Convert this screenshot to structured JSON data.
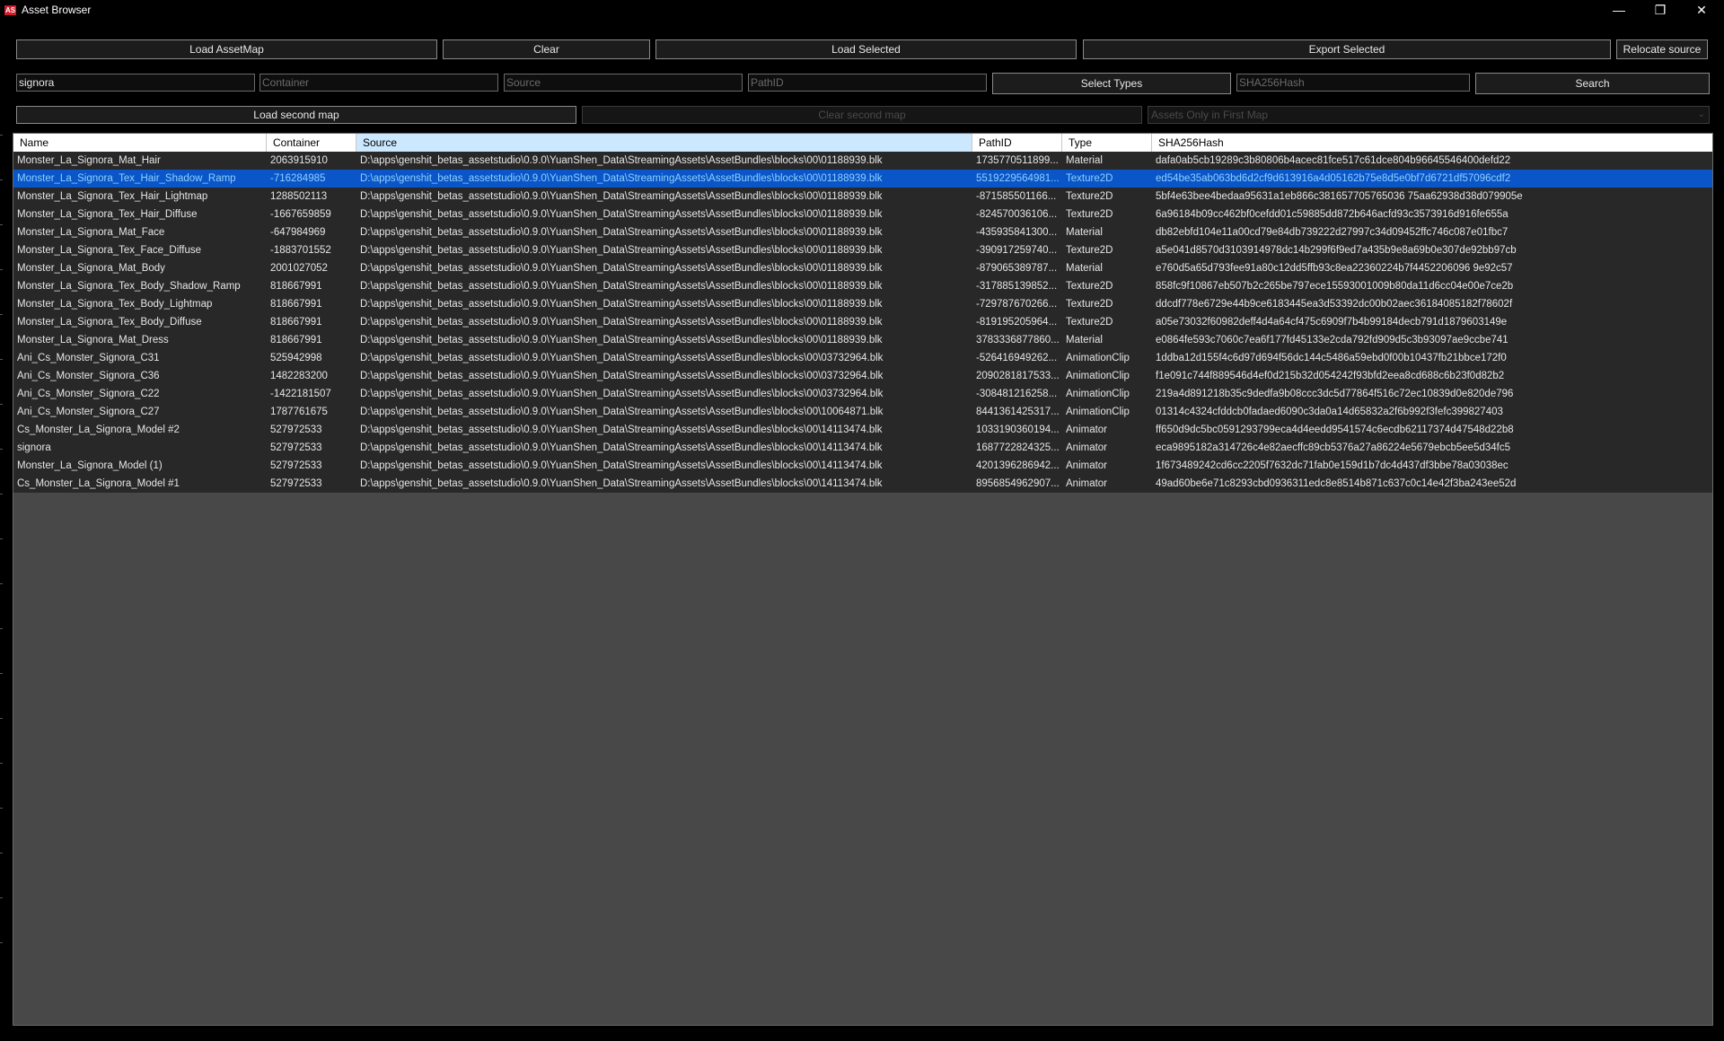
{
  "window": {
    "title": "Asset Browser",
    "icon_text": "AS",
    "minimize_glyph": "—",
    "maximize_glyph": "❐",
    "close_glyph": "✕"
  },
  "toolbar": {
    "load_assetmap": "Load AssetMap",
    "clear": "Clear",
    "load_selected": "Load Selected",
    "export_selected": "Export Selected",
    "relocate_source": "Relocate source"
  },
  "filters": {
    "name_value": "signora",
    "container_placeholder": "Container",
    "source_placeholder": "Source",
    "pathid_placeholder": "PathID",
    "select_types": "Select Types",
    "sha_placeholder": "SHA256Hash",
    "search": "Search"
  },
  "second_map": {
    "load_second_map": "Load second map",
    "clear_second_map": "Clear second map",
    "assets_only_first": "Assets Only in First Map"
  },
  "columns": [
    "Name",
    "Container",
    "Source",
    "PathID",
    "Type",
    "SHA256Hash"
  ],
  "rows": [
    {
      "name": "Monster_La_Signora_Mat_Hair",
      "container": "2063915910",
      "source": "D:\\apps\\genshit_betas_assetstudio\\0.9.0\\YuanShen_Data\\StreamingAssets\\AssetBundles\\blocks\\00\\01188939.blk",
      "pathid": "1735770511899...",
      "type": "Material",
      "hash": "dafa0ab5cb19289c3b80806b4acec81fce517c61dce804b96645546400defd22"
    },
    {
      "name": "Monster_La_Signora_Tex_Hair_Shadow_Ramp",
      "container": "-716284985",
      "source": "D:\\apps\\genshit_betas_assetstudio\\0.9.0\\YuanShen_Data\\StreamingAssets\\AssetBundles\\blocks\\00\\01188939.blk",
      "pathid": "5519229564981...",
      "type": "Texture2D",
      "hash": "ed54be35ab063bd6d2cf9d613916a4d05162b75e8d5e0bf7d6721df57096cdf2",
      "selected": true
    },
    {
      "name": "Monster_La_Signora_Tex_Hair_Lightmap",
      "container": "1288502113",
      "source": "D:\\apps\\genshit_betas_assetstudio\\0.9.0\\YuanShen_Data\\StreamingAssets\\AssetBundles\\blocks\\00\\01188939.blk",
      "pathid": "-871585501166...",
      "type": "Texture2D",
      "hash": "5bf4e63bee4bedaa95631a1eb866c381657705765036 75aa62938d38d079905e"
    },
    {
      "name": "Monster_La_Signora_Tex_Hair_Diffuse",
      "container": "-1667659859",
      "source": "D:\\apps\\genshit_betas_assetstudio\\0.9.0\\YuanShen_Data\\StreamingAssets\\AssetBundles\\blocks\\00\\01188939.blk",
      "pathid": "-824570036106...",
      "type": "Texture2D",
      "hash": "6a96184b09cc462bf0cefdd01c59885dd872b646acfd93c3573916d916fe655a"
    },
    {
      "name": "Monster_La_Signora_Mat_Face",
      "container": "-647984969",
      "source": "D:\\apps\\genshit_betas_assetstudio\\0.9.0\\YuanShen_Data\\StreamingAssets\\AssetBundles\\blocks\\00\\01188939.blk",
      "pathid": "-435935841300...",
      "type": "Material",
      "hash": "db82ebfd104e11a00cd79e84db739222d27997c34d09452ffc746c087e01fbc7"
    },
    {
      "name": "Monster_La_Signora_Tex_Face_Diffuse",
      "container": "-1883701552",
      "source": "D:\\apps\\genshit_betas_assetstudio\\0.9.0\\YuanShen_Data\\StreamingAssets\\AssetBundles\\blocks\\00\\01188939.blk",
      "pathid": "-390917259740...",
      "type": "Texture2D",
      "hash": "a5e041d8570d3103914978dc14b299f6f9ed7a435b9e8a69b0e307de92bb97cb"
    },
    {
      "name": "Monster_La_Signora_Mat_Body",
      "container": "2001027052",
      "source": "D:\\apps\\genshit_betas_assetstudio\\0.9.0\\YuanShen_Data\\StreamingAssets\\AssetBundles\\blocks\\00\\01188939.blk",
      "pathid": "-879065389787...",
      "type": "Material",
      "hash": "e760d5a65d793fee91a80c12dd5ffb93c8ea22360224b7f4452206096 9e92c57"
    },
    {
      "name": "Monster_La_Signora_Tex_Body_Shadow_Ramp",
      "container": "818667991",
      "source": "D:\\apps\\genshit_betas_assetstudio\\0.9.0\\YuanShen_Data\\StreamingAssets\\AssetBundles\\blocks\\00\\01188939.blk",
      "pathid": "-317885139852...",
      "type": "Texture2D",
      "hash": "858fc9f10867eb507b2c265be797ece15593001009b80da11d6cc04e00e7ce2b"
    },
    {
      "name": "Monster_La_Signora_Tex_Body_Lightmap",
      "container": "818667991",
      "source": "D:\\apps\\genshit_betas_assetstudio\\0.9.0\\YuanShen_Data\\StreamingAssets\\AssetBundles\\blocks\\00\\01188939.blk",
      "pathid": "-729787670266...",
      "type": "Texture2D",
      "hash": "ddcdf778e6729e44b9ce6183445ea3d53392dc00b02aec36184085182f78602f"
    },
    {
      "name": "Monster_La_Signora_Tex_Body_Diffuse",
      "container": "818667991",
      "source": "D:\\apps\\genshit_betas_assetstudio\\0.9.0\\YuanShen_Data\\StreamingAssets\\AssetBundles\\blocks\\00\\01188939.blk",
      "pathid": "-819195205964...",
      "type": "Texture2D",
      "hash": "a05e73032f60982deff4d4a64cf475c6909f7b4b99184decb791d1879603149e"
    },
    {
      "name": "Monster_La_Signora_Mat_Dress",
      "container": "818667991",
      "source": "D:\\apps\\genshit_betas_assetstudio\\0.9.0\\YuanShen_Data\\StreamingAssets\\AssetBundles\\blocks\\00\\01188939.blk",
      "pathid": "3783336877860...",
      "type": "Material",
      "hash": "e0864fe593c7060c7ea6f177fd45133e2cda792fd909d5c3b93097ae9ccbe741"
    },
    {
      "name": "Ani_Cs_Monster_Signora_C31",
      "container": "525942998",
      "source": "D:\\apps\\genshit_betas_assetstudio\\0.9.0\\YuanShen_Data\\StreamingAssets\\AssetBundles\\blocks\\00\\03732964.blk",
      "pathid": "-526416949262...",
      "type": "AnimationClip",
      "hash": "1ddba12d155f4c6d97d694f56dc144c5486a59ebd0f00b10437fb21bbce172f0"
    },
    {
      "name": "Ani_Cs_Monster_Signora_C36",
      "container": "1482283200",
      "source": "D:\\apps\\genshit_betas_assetstudio\\0.9.0\\YuanShen_Data\\StreamingAssets\\AssetBundles\\blocks\\00\\03732964.blk",
      "pathid": "2090281817533...",
      "type": "AnimationClip",
      "hash": "f1e091c744f889546d4ef0d215b32d054242f93bfd2eea8cd688c6b23f0d82b2"
    },
    {
      "name": "Ani_Cs_Monster_Signora_C22",
      "container": "-1422181507",
      "source": "D:\\apps\\genshit_betas_assetstudio\\0.9.0\\YuanShen_Data\\StreamingAssets\\AssetBundles\\blocks\\00\\03732964.blk",
      "pathid": "-308481216258...",
      "type": "AnimationClip",
      "hash": "219a4d891218b35c9dedfa9b08ccc3dc5d77864f516c72ec10839d0e820de796"
    },
    {
      "name": "Ani_Cs_Monster_Signora_C27",
      "container": "1787761675",
      "source": "D:\\apps\\genshit_betas_assetstudio\\0.9.0\\YuanShen_Data\\StreamingAssets\\AssetBundles\\blocks\\00\\10064871.blk",
      "pathid": "8441361425317...",
      "type": "AnimationClip",
      "hash": "01314c4324cfddcb0fadaed6090c3da0a14d65832a2f6b992f3fefc399827403"
    },
    {
      "name": "Cs_Monster_La_Signora_Model #2",
      "container": "527972533",
      "source": "D:\\apps\\genshit_betas_assetstudio\\0.9.0\\YuanShen_Data\\StreamingAssets\\AssetBundles\\blocks\\00\\14113474.blk",
      "pathid": "1033190360194...",
      "type": "Animator",
      "hash": "ff650d9dc5bc0591293799eca4d4eedd9541574c6ecdb62117374d47548d22b8"
    },
    {
      "name": "signora",
      "container": "527972533",
      "source": "D:\\apps\\genshit_betas_assetstudio\\0.9.0\\YuanShen_Data\\StreamingAssets\\AssetBundles\\blocks\\00\\14113474.blk",
      "pathid": "1687722824325...",
      "type": "Animator",
      "hash": "eca9895182a314726c4e82aecffc89cb5376a27a86224e5679ebcb5ee5d34fc5"
    },
    {
      "name": "Monster_La_Signora_Model (1)",
      "container": "527972533",
      "source": "D:\\apps\\genshit_betas_assetstudio\\0.9.0\\YuanShen_Data\\StreamingAssets\\AssetBundles\\blocks\\00\\14113474.blk",
      "pathid": "4201396286942...",
      "type": "Animator",
      "hash": "1f673489242cd6cc2205f7632dc71fab0e159d1b7dc4d437df3bbe78a03038ec"
    },
    {
      "name": "Cs_Monster_La_Signora_Model #1",
      "container": "527972533",
      "source": "D:\\apps\\genshit_betas_assetstudio\\0.9.0\\YuanShen_Data\\StreamingAssets\\AssetBundles\\blocks\\00\\14113474.blk",
      "pathid": "8956854962907...",
      "type": "Animator",
      "hash": "49ad60be6e71c8293cbd0936311edc8e8514b871c637c0c14e42f3ba243ee52d"
    }
  ],
  "colors": {
    "background": "#000000",
    "grid_bg": "#484848",
    "row_bg": "#282828",
    "selected_row": "#0a55c7",
    "selected_text": "#8fd0ff",
    "sorted_header": "#cce8ff"
  }
}
